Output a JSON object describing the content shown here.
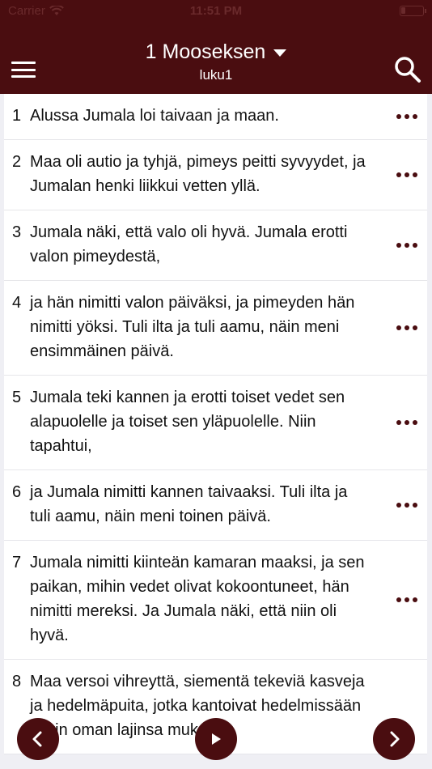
{
  "status": {
    "carrier": "Carrier",
    "time": "11:51 PM"
  },
  "header": {
    "book": "1 Mooseksen",
    "chapter": "luku1"
  },
  "verses": [
    {
      "num": "1",
      "text": "Alussa Jumala loi taivaan ja maan."
    },
    {
      "num": "2",
      "text": "Maa oli autio ja tyhjä, pimeys peitti syvyydet, ja Jumalan henki liikkui vetten yllä."
    },
    {
      "num": "3",
      "text": "Jumala näki, että valo oli hyvä. Jumala erotti valon pimeydestä,"
    },
    {
      "num": "4",
      "text": "ja hän nimitti valon päiväksi, ja pimeyden hän nimitti yöksi. Tuli ilta ja tuli aamu, näin meni ensimmäinen päivä."
    },
    {
      "num": "5",
      "text": "Jumala teki kannen ja erotti toiset vedet sen alapuolelle ja toiset sen yläpuolelle. Niin tapahtui,"
    },
    {
      "num": "6",
      "text": "ja Jumala nimitti kannen taivaaksi. Tuli ilta ja tuli aamu, näin meni toinen päivä."
    },
    {
      "num": "7",
      "text": "Jumala nimitti kiinteän kamaran maaksi, ja sen paikan, mihin vedet olivat kokoontuneet, hän nimitti mereksi. Ja Jumala näki, että niin oli hyvä."
    },
    {
      "num": "8",
      "text": "Maa versoi vihreyttä, siementä tekeviä kasveja ja hedelmäpuita, jotka kantoivat hedelmissään kukin oman lajinsa mukaista"
    }
  ],
  "icons": {
    "menu": "menu-icon",
    "search": "search-icon",
    "more": "more-options-icon",
    "prev": "chevron-left-icon",
    "play": "play-icon",
    "next": "chevron-right-icon"
  },
  "colors": {
    "accent": "#4a0d10",
    "background": "#efeff4"
  }
}
